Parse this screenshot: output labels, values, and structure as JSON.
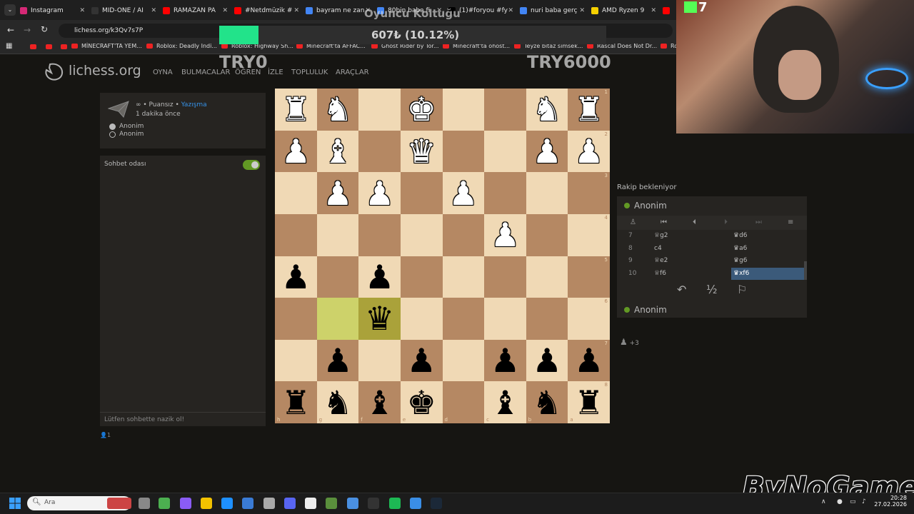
{
  "browser": {
    "tabs": [
      {
        "label": "Instagram",
        "color": "#d62976"
      },
      {
        "label": "MID-ONE / AI",
        "color": "#333333"
      },
      {
        "label": "RAMAZAN PA",
        "color": "#ff0000"
      },
      {
        "label": "#Netdmüzik #",
        "color": "#ff0000"
      },
      {
        "label": "bayram ne zan",
        "color": "#4285f4"
      },
      {
        "label": "80bin baba fi",
        "color": "#4285f4"
      },
      {
        "label": "(1)#foryou #fy",
        "color": "#000000"
      },
      {
        "label": "nuri baba gerç",
        "color": "#4285f4"
      },
      {
        "label": "AMD Ryzen 9",
        "color": "#f5d000"
      },
      {
        "label": "",
        "color": "#ff0000"
      }
    ],
    "url": "lichess.org/k3Qv7s7P",
    "bookmarks": [
      "MİNECRAFT'TA YEM...",
      "Roblox: Deadly Indi...",
      "Roblox: Highway Sh...",
      "Minecraft'ta AFFAC...",
      "Ghost Rider by Tor...",
      "Minecraft'ta ohost...",
      "Teyze bitaz simsek...",
      "Rascal Does Not Dr...",
      "Ro"
    ]
  },
  "overlay": {
    "title": "Oyuncu Koltuğu",
    "progress_text": "607₺ (10.12%)",
    "progress_fraction": 0.1012,
    "left_label": "TRY0",
    "right_label": "TRY6000"
  },
  "webcam": {
    "badge": "7"
  },
  "lichess": {
    "brand": "lichess.org",
    "nav": [
      "OYNA",
      "BULMACALAR",
      "ÖĞREN",
      "İZLE",
      "TOPLULUK",
      "ARAÇLAR"
    ],
    "game": {
      "mode": "∞ • Puansız • ",
      "mode_link": "Yazışma",
      "time": "1 dakika önce",
      "players": [
        "Anonim",
        "Anonim"
      ]
    },
    "chat": {
      "title": "Sohbet odası",
      "placeholder": "Lütfen sohbette nazik ol!",
      "watchers": "1"
    },
    "board": {
      "rank_coords": [
        "1",
        "2",
        "3",
        "4",
        "5",
        "6",
        "7",
        "8"
      ],
      "file_coords": [
        "h",
        "g",
        "f",
        "e",
        "d",
        "c",
        "b",
        "a"
      ],
      "rows": [
        [
          "wR",
          "wN",
          "",
          "wK",
          "",
          "",
          "wN",
          "wR"
        ],
        [
          "wP",
          "wB",
          "",
          "wQ",
          "",
          "",
          "wP",
          "wP"
        ],
        [
          "",
          "wP",
          "wP",
          "",
          "wP",
          "",
          "",
          ""
        ],
        [
          "",
          "",
          "",
          "",
          "",
          "wP",
          "",
          ""
        ],
        [
          "bP",
          "",
          "bP",
          "",
          "",
          "",
          "",
          ""
        ],
        [
          "",
          "",
          "bQ",
          "",
          "",
          "",
          "",
          ""
        ],
        [
          "",
          "bP",
          "",
          "bP",
          "",
          "bP",
          "bP",
          "bP"
        ],
        [
          "bR",
          "bN",
          "bB",
          "bK",
          "",
          "bB",
          "bN",
          "bR"
        ]
      ],
      "highlight": [
        [
          5,
          1
        ],
        [
          5,
          2
        ]
      ]
    },
    "side": {
      "waiting": "Rakip bekleniyor",
      "top_player": "Anonim",
      "bottom_player": "Anonim",
      "moves": [
        {
          "n": "7",
          "w": "♕g2",
          "b": "♛d6"
        },
        {
          "n": "8",
          "w": "c4",
          "b": "♛a6"
        },
        {
          "n": "9",
          "w": "♕e2",
          "b": "♛g6"
        },
        {
          "n": "10",
          "w": "♕f6",
          "b": "♛xf6"
        }
      ],
      "draw_label": "½",
      "material": "+3"
    }
  },
  "watermark": "ByNoGame",
  "taskbar": {
    "search_placeholder": "Ara",
    "time": "20:28",
    "date": "27.02.2026"
  }
}
